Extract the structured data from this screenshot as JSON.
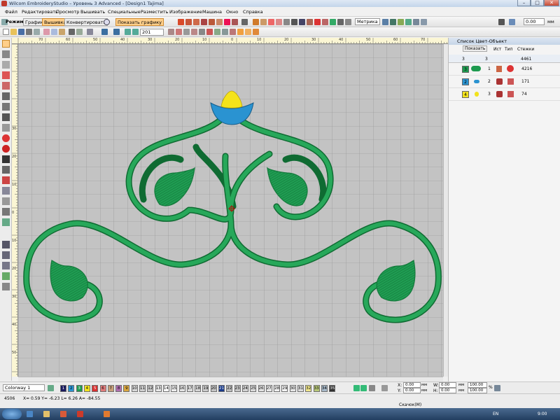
{
  "window": {
    "title": "Wilcom EmbroideryStudio – Уровень 3 Advanced - [Design1     Tajima]"
  },
  "menu": [
    "Файл",
    "Редактировать",
    "Просмотр",
    "Вышивать",
    "Специальные",
    "Разместить",
    "Изображение",
    "Машина",
    "Окно",
    "Справка"
  ],
  "toolbar": {
    "mode_label": "Режим:",
    "mode_graphics": "Графика",
    "mode_embroidery": "Вышивка",
    "mode_convert": "Конвертировать",
    "show_graphics": "Показать графику",
    "units": "Метрика",
    "zoom_value": "201",
    "size_value": "0.00",
    "size_unit": "мм"
  },
  "rulers": {
    "top_labels": [
      "70",
      "60",
      "50",
      "40",
      "30",
      "20",
      "10",
      "0",
      "10",
      "20",
      "30",
      "40",
      "50",
      "60",
      "70"
    ],
    "left_labels": [
      "30",
      "20",
      "10",
      "0",
      "10",
      "20",
      "30",
      "40",
      "50",
      "60"
    ]
  },
  "panel": {
    "title": "Список Цвет-Объект",
    "show_button": "Показать",
    "columns": [
      "Ист",
      "Тип",
      "Стежки"
    ],
    "totals": {
      "a": "3",
      "b": "3",
      "stitches": "4461"
    },
    "rows": [
      {
        "color_num": "3",
        "color": "#1d9a4f",
        "order": "1",
        "stitches": "4216"
      },
      {
        "color_num": "2",
        "color": "#2a93d1",
        "order": "2",
        "stitches": "171"
      },
      {
        "color_num": "4",
        "color": "#f2e21d",
        "order": "3",
        "stitches": "74"
      }
    ]
  },
  "colorbar": {
    "colorway": "Colorway 1",
    "swatches": [
      {
        "n": "1",
        "c": "#1a1a5e"
      },
      {
        "n": "2",
        "c": "#2a93d1"
      },
      {
        "n": "3",
        "c": "#1d9a4f"
      },
      {
        "n": "4",
        "c": "#f2e21d"
      },
      {
        "n": "5",
        "c": "#d93030"
      },
      {
        "n": "6",
        "c": "#e07b7b"
      },
      {
        "n": "7",
        "c": "#c8a07a"
      },
      {
        "n": "8",
        "c": "#b06fb0"
      },
      {
        "n": "9",
        "c": "#d9a640"
      },
      {
        "n": "10",
        "c": "#d8d8d8"
      },
      {
        "n": "11",
        "c": "#d0d0d0"
      },
      {
        "n": "12",
        "c": "#c8c8c8"
      },
      {
        "n": "13",
        "c": "#eaeaea"
      },
      {
        "n": "14",
        "c": "#ffffff"
      },
      {
        "n": "15",
        "c": "#eeeeee"
      },
      {
        "n": "16",
        "c": "#e4e4e4"
      },
      {
        "n": "17",
        "c": "#dddddd"
      },
      {
        "n": "18",
        "c": "#d5d5d5"
      },
      {
        "n": "19",
        "c": "#cccccc"
      },
      {
        "n": "20",
        "c": "#c4c4c4"
      },
      {
        "n": "21",
        "c": "#1a3a8a"
      },
      {
        "n": "22",
        "c": "#bfbfbf"
      },
      {
        "n": "23",
        "c": "#c9c9c9"
      },
      {
        "n": "24",
        "c": "#d2d2d2"
      },
      {
        "n": "25",
        "c": "#dadada"
      },
      {
        "n": "26",
        "c": "#e2e2e2"
      },
      {
        "n": "27",
        "c": "#e8e8e8"
      },
      {
        "n": "28",
        "c": "#efefef"
      },
      {
        "n": "29",
        "c": "#f4f4f4"
      },
      {
        "n": "30",
        "c": "#e6e6e6"
      },
      {
        "n": "31",
        "c": "#dcdcdc"
      },
      {
        "n": "32",
        "c": "#f0e68c"
      },
      {
        "n": "33",
        "c": "#b8c878"
      },
      {
        "n": "34",
        "c": "#a6b8c8"
      },
      {
        "n": "35",
        "c": "#303030"
      }
    ],
    "x_label": "X:",
    "x_value": "0.00",
    "x_unit": "мм",
    "y_label": "Y:",
    "y_value": "0.00",
    "y_unit": "мм",
    "w_label": "W:",
    "w_value": "0.00",
    "w_unit": "мм",
    "h_label": "H:",
    "h_value": "0.00",
    "h_unit": "мм",
    "scale_w": "100.00",
    "scale_h": "100.00",
    "scale_unit": "%"
  },
  "status": {
    "stitches": "4506",
    "coords": "X=   0.59 Y=  -6.23 L=  6.26 A= -84.55",
    "message": "Скачок(M)"
  },
  "taskbar": {
    "lang": "EN",
    "time": "9:00"
  }
}
